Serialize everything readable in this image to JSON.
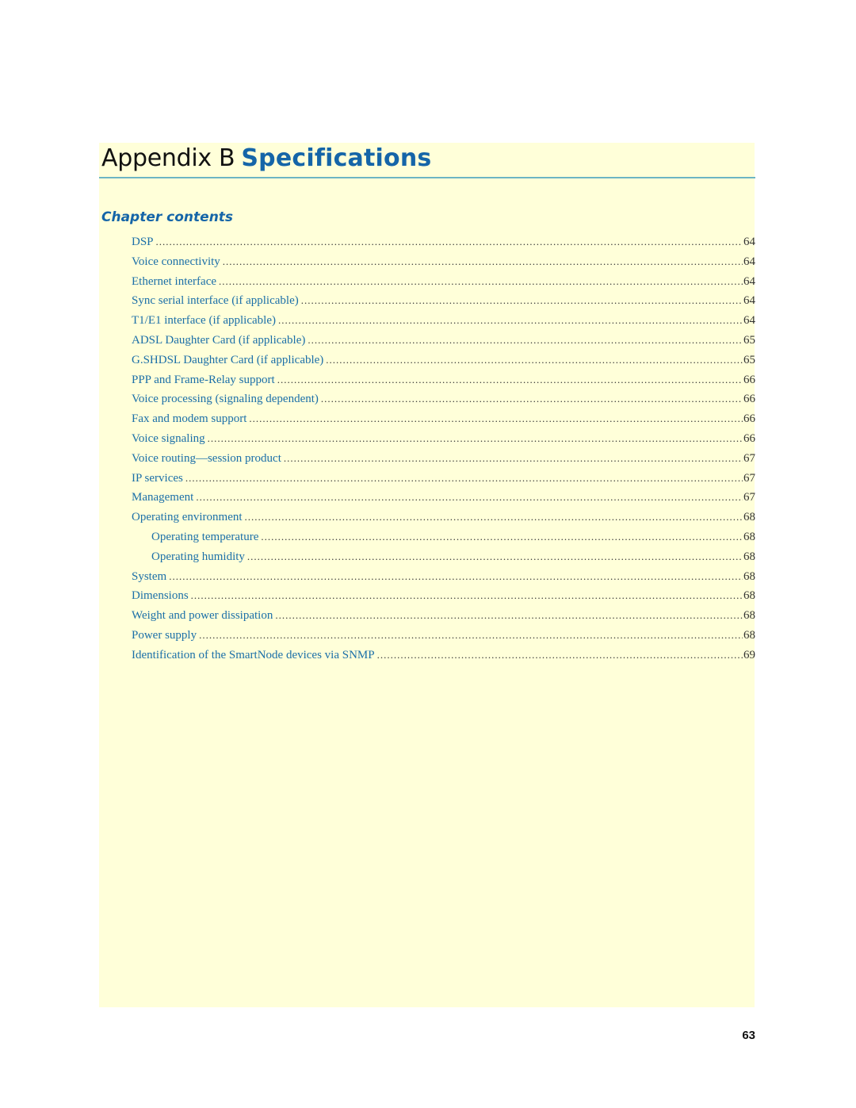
{
  "header": {
    "prefix": "Appendix B",
    "title": "Specifications"
  },
  "section": {
    "title": "Chapter contents"
  },
  "toc": [
    {
      "label": "DSP",
      "page": "64",
      "level": 1
    },
    {
      "label": "Voice connectivity",
      "page": "64",
      "level": 1
    },
    {
      "label": "Ethernet interface",
      "page": "64",
      "level": 1
    },
    {
      "label": "Sync serial interface (if applicable)",
      "page": "64",
      "level": 1
    },
    {
      "label": "T1/E1 interface (if applicable)",
      "page": "64",
      "level": 1
    },
    {
      "label": "ADSL Daughter Card (if applicable)",
      "page": "65",
      "level": 1
    },
    {
      "label": "G.SHDSL Daughter Card (if applicable)",
      "page": "65",
      "level": 1
    },
    {
      "label": "PPP and Frame-Relay support",
      "page": "66",
      "level": 1
    },
    {
      "label": "Voice processing (signaling dependent)",
      "page": "66",
      "level": 1
    },
    {
      "label": "Fax and modem support",
      "page": "66",
      "level": 1
    },
    {
      "label": "Voice signaling",
      "page": "66",
      "level": 1
    },
    {
      "label": "Voice routing—session product",
      "page": "67",
      "level": 1
    },
    {
      "label": "IP services",
      "page": "67",
      "level": 1
    },
    {
      "label": "Management",
      "page": "67",
      "level": 1
    },
    {
      "label": "Operating environment",
      "page": "68",
      "level": 1
    },
    {
      "label": "Operating temperature",
      "page": "68",
      "level": 2
    },
    {
      "label": "Operating humidity",
      "page": "68",
      "level": 2
    },
    {
      "label": "System",
      "page": "68",
      "level": 1
    },
    {
      "label": "Dimensions",
      "page": "68",
      "level": 1
    },
    {
      "label": "Weight and power dissipation",
      "page": "68",
      "level": 1
    },
    {
      "label": "Power supply",
      "page": "68",
      "level": 1
    },
    {
      "label": "Identification of the SmartNode devices via SNMP",
      "page": "69",
      "level": 1
    }
  ],
  "footer": {
    "page_number": "63"
  },
  "colors": {
    "panel_background": "#ffffd9",
    "accent_blue": "#1565a8",
    "link_blue": "#1b6fa8",
    "rule": "#6db5c4"
  }
}
